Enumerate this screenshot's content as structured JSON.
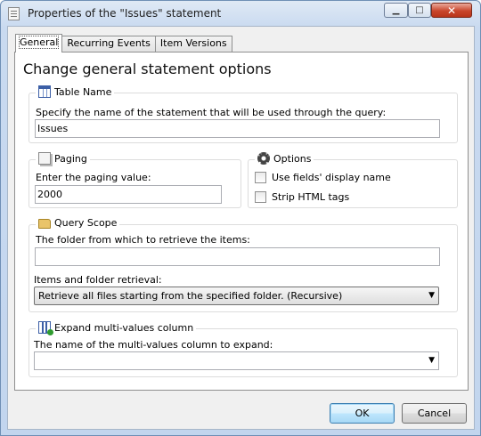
{
  "window": {
    "title": "Properties of the \"Issues\" statement",
    "controls": {
      "minimize": "▁",
      "maximize": "□",
      "close": "✕"
    }
  },
  "tabs": [
    {
      "label": "General",
      "active": true
    },
    {
      "label": "Recurring Events",
      "active": false
    },
    {
      "label": "Item Versions",
      "active": false
    }
  ],
  "heading": "Change general statement options",
  "table_name": {
    "legend": "Table Name",
    "icon": "table-icon",
    "description": "Specify the name of the statement that will be used through the query:",
    "value": "Issues"
  },
  "paging": {
    "legend": "Paging",
    "icon": "pages-icon",
    "description": "Enter the paging value:",
    "value": "2000"
  },
  "options": {
    "legend": "Options",
    "icon": "gear-icon",
    "checkboxes": [
      {
        "label": "Use fields' display name",
        "checked": false
      },
      {
        "label": "Strip HTML tags",
        "checked": false
      }
    ]
  },
  "query_scope": {
    "legend": "Query Scope",
    "icon": "folder-icon",
    "folder_label": "The folder from which to retrieve the items:",
    "folder_value": "",
    "retrieval_label": "Items and folder retrieval:",
    "retrieval_value": "Retrieve all files starting from the specified folder. (Recursive)"
  },
  "expand": {
    "legend": "Expand multi-values column",
    "icon": "columns-icon",
    "description": "The name of the multi-values column to expand:",
    "value": ""
  },
  "buttons": {
    "ok": "OK",
    "cancel": "Cancel"
  },
  "combo_arrow": "▼"
}
